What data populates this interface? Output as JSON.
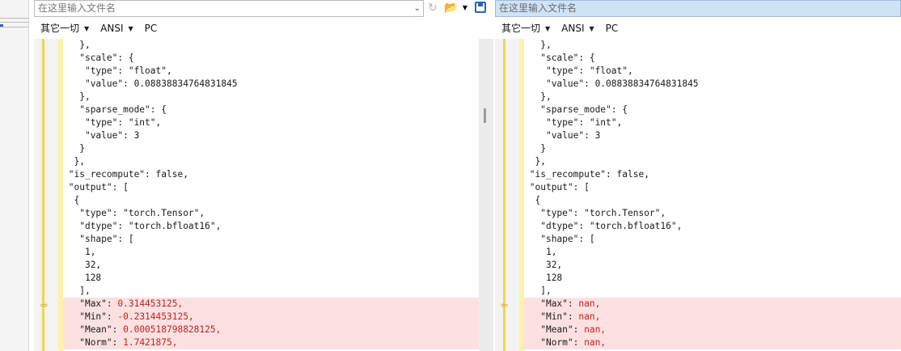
{
  "left": {
    "path_placeholder": "在这里输入文件名",
    "format": {
      "encoding_group": "其它一切",
      "charset": "ANSI",
      "line_ending": "PC"
    }
  },
  "right": {
    "path_placeholder": "在这里输入文件名",
    "format": {
      "encoding_group": "其它一切",
      "charset": "ANSI",
      "line_ending": "PC"
    }
  },
  "icons": {
    "dropdown": "chevron-down-icon",
    "reload": "reload-icon",
    "open": "folder-open-icon",
    "save": "save-icon",
    "diff_marker": "arrow-right-icon"
  },
  "colors": {
    "diff_background": "#fde1e1",
    "diff_text": "#c81e1e",
    "selected_path": "#cfe3f7",
    "gutter_highlight": "#fff2a8"
  },
  "left_code": [
    {
      "indent": "   ",
      "text": "},",
      "diff": false
    },
    {
      "indent": "   ",
      "text": "\"scale\": {",
      "diff": false
    },
    {
      "indent": "    ",
      "text": "\"type\": \"float\",",
      "diff": false
    },
    {
      "indent": "    ",
      "text": "\"value\": 0.08838834764831845",
      "diff": false
    },
    {
      "indent": "   ",
      "text": "},",
      "diff": false
    },
    {
      "indent": "   ",
      "text": "\"sparse_mode\": {",
      "diff": false
    },
    {
      "indent": "    ",
      "text": "\"type\": \"int\",",
      "diff": false
    },
    {
      "indent": "    ",
      "text": "\"value\": 3",
      "diff": false
    },
    {
      "indent": "   ",
      "text": "}",
      "diff": false
    },
    {
      "indent": "  ",
      "text": "},",
      "diff": false
    },
    {
      "indent": " ",
      "text": "\"is_recompute\": false,",
      "diff": false
    },
    {
      "indent": " ",
      "text": "\"output\": [",
      "diff": false
    },
    {
      "indent": "  ",
      "text": "{",
      "diff": false
    },
    {
      "indent": "   ",
      "text": "\"type\": \"torch.Tensor\",",
      "diff": false
    },
    {
      "indent": "   ",
      "text": "\"dtype\": \"torch.bfloat16\",",
      "diff": false
    },
    {
      "indent": "   ",
      "text": "\"shape\": [",
      "diff": false
    },
    {
      "indent": "    ",
      "text": "1,",
      "diff": false
    },
    {
      "indent": "    ",
      "text": "32,",
      "diff": false
    },
    {
      "indent": "    ",
      "text": "128",
      "diff": false
    },
    {
      "indent": "   ",
      "text": "],",
      "diff": false
    },
    {
      "indent": "   ",
      "key": "\"Max\": ",
      "val": "0.314453125,",
      "diff": true
    },
    {
      "indent": "   ",
      "key": "\"Min\": ",
      "val": "-0.2314453125,",
      "diff": true
    },
    {
      "indent": "   ",
      "key": "\"Mean\": ",
      "val": "0.000518798828125,",
      "diff": true
    },
    {
      "indent": "   ",
      "key": "\"Norm\": ",
      "val": "1.7421875,",
      "diff": true
    }
  ],
  "right_code": [
    {
      "indent": "   ",
      "text": "},",
      "diff": false
    },
    {
      "indent": "   ",
      "text": "\"scale\": {",
      "diff": false
    },
    {
      "indent": "    ",
      "text": "\"type\": \"float\",",
      "diff": false
    },
    {
      "indent": "    ",
      "text": "\"value\": 0.08838834764831845",
      "diff": false
    },
    {
      "indent": "   ",
      "text": "},",
      "diff": false
    },
    {
      "indent": "   ",
      "text": "\"sparse_mode\": {",
      "diff": false
    },
    {
      "indent": "    ",
      "text": "\"type\": \"int\",",
      "diff": false
    },
    {
      "indent": "    ",
      "text": "\"value\": 3",
      "diff": false
    },
    {
      "indent": "   ",
      "text": "}",
      "diff": false
    },
    {
      "indent": "  ",
      "text": "},",
      "diff": false
    },
    {
      "indent": " ",
      "text": "\"is_recompute\": false,",
      "diff": false
    },
    {
      "indent": " ",
      "text": "\"output\": [",
      "diff": false
    },
    {
      "indent": "  ",
      "text": "{",
      "diff": false
    },
    {
      "indent": "   ",
      "text": "\"type\": \"torch.Tensor\",",
      "diff": false
    },
    {
      "indent": "   ",
      "text": "\"dtype\": \"torch.bfloat16\",",
      "diff": false
    },
    {
      "indent": "   ",
      "text": "\"shape\": [",
      "diff": false
    },
    {
      "indent": "    ",
      "text": "1,",
      "diff": false
    },
    {
      "indent": "    ",
      "text": "32,",
      "diff": false
    },
    {
      "indent": "    ",
      "text": "128",
      "diff": false
    },
    {
      "indent": "   ",
      "text": "],",
      "diff": false
    },
    {
      "indent": "   ",
      "key": "\"Max\": ",
      "val": "nan,",
      "diff": true
    },
    {
      "indent": "   ",
      "key": "\"Min\": ",
      "val": "nan,",
      "diff": true
    },
    {
      "indent": "   ",
      "key": "\"Mean\": ",
      "val": "nan,",
      "diff": true
    },
    {
      "indent": "   ",
      "key": "\"Norm\": ",
      "val": "nan,",
      "diff": true
    }
  ]
}
